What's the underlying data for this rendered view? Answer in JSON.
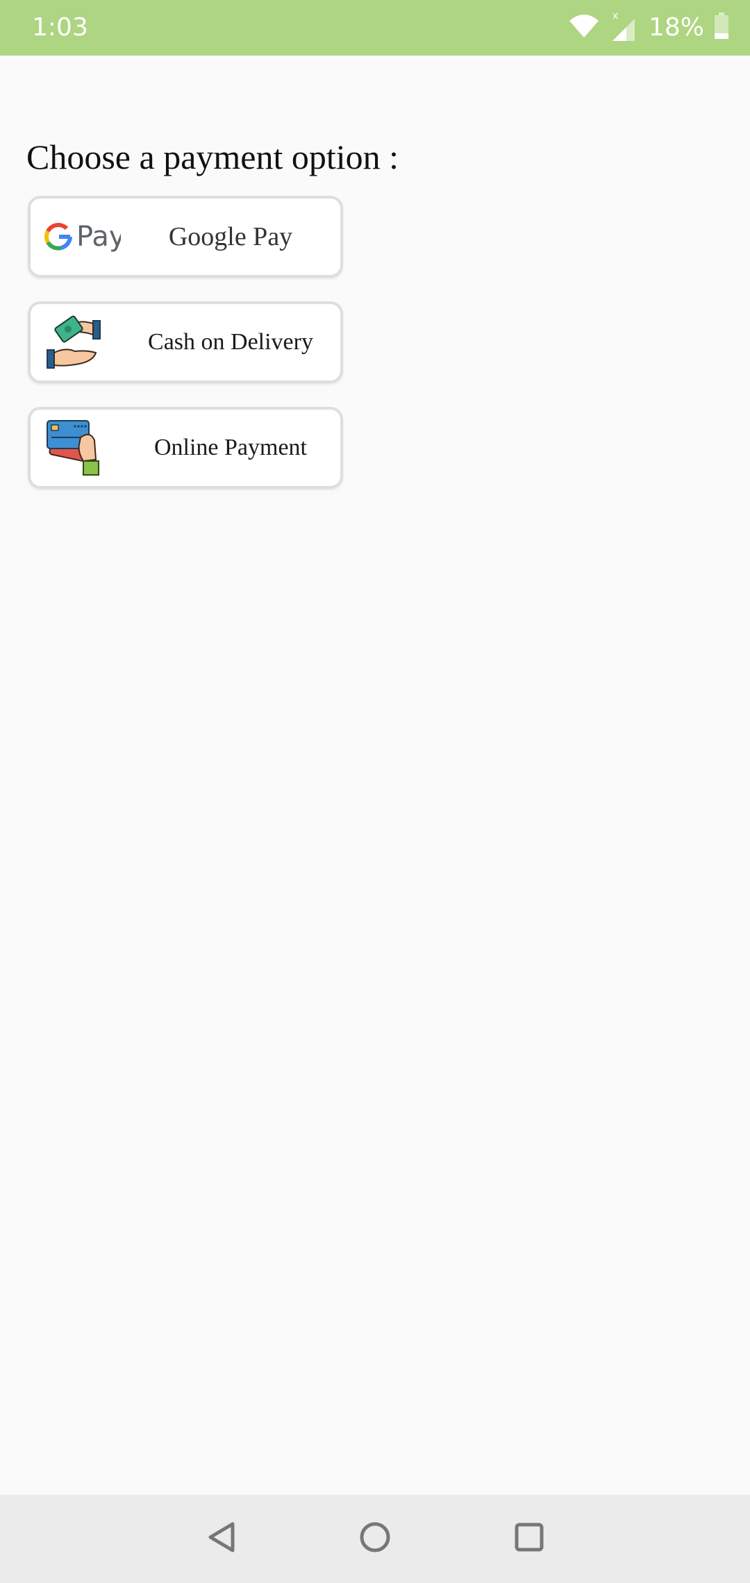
{
  "status_bar": {
    "time": "1:03",
    "battery": "18%",
    "background_color": "#aed581",
    "icons": [
      "wifi-icon",
      "signal-icon",
      "battery-icon"
    ]
  },
  "main": {
    "title": "Choose a payment option :",
    "options": [
      {
        "label": "Google Pay",
        "icon": "google-pay-logo",
        "logo_text": "Pay"
      },
      {
        "label": "Cash on Delivery",
        "icon": "cash-hands-icon"
      },
      {
        "label": "Online Payment",
        "icon": "credit-card-hand-icon"
      }
    ]
  },
  "nav_bar": {
    "buttons": [
      "back-icon",
      "home-icon",
      "recents-icon"
    ]
  }
}
